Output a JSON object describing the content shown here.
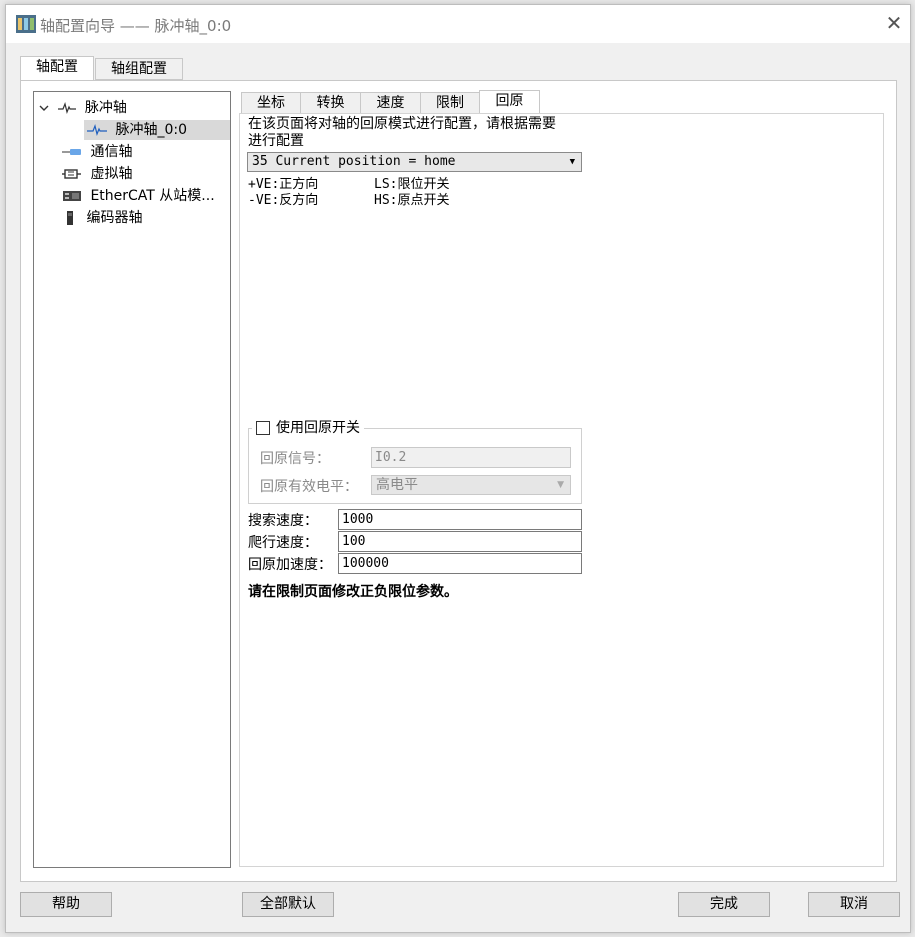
{
  "window": {
    "title": "轴配置向导 —— 脉冲轴_0:0"
  },
  "top_tabs": [
    {
      "label": "轴配置"
    },
    {
      "label": "轴组配置"
    }
  ],
  "tree": {
    "items": [
      {
        "label": "脉冲轴",
        "icon": "pulse-icon"
      },
      {
        "label": "脉冲轴_0:0",
        "icon": "pulse-icon"
      },
      {
        "label": "通信轴",
        "icon": "comm-axis-icon"
      },
      {
        "label": "虚拟轴",
        "icon": "virtual-axis-icon"
      },
      {
        "label": "EtherCAT 从站模...",
        "icon": "ethercat-icon"
      },
      {
        "label": "编码器轴",
        "icon": "encoder-icon"
      }
    ]
  },
  "sub_tabs": [
    {
      "label": "坐标"
    },
    {
      "label": "转换"
    },
    {
      "label": "速度"
    },
    {
      "label": "限制"
    },
    {
      "label": "回原"
    }
  ],
  "homing": {
    "description_line1": "在该页面将对轴的回原模式进行配置，请根据需要",
    "description_line2": "进行配置",
    "mode_value": "35 Current position = home",
    "legend": {
      "pve": "+VE:正方向",
      "ls": "LS:限位开关",
      "nve": "-VE:反方向",
      "hs": "HS:原点开关"
    },
    "use_switch_label": "使用回原开关",
    "signal_label": "回原信号：",
    "signal_value": "I0.2",
    "level_label": "回原有效电平：",
    "level_value": "高电平",
    "search_speed_label": "搜索速度：",
    "search_speed_value": "1000",
    "creep_speed_label": "爬行速度：",
    "creep_speed_value": "100",
    "accel_label": "回原加速度：",
    "accel_value": "100000",
    "note": "请在限制页面修改正负限位参数。"
  },
  "buttons": {
    "help": "帮助",
    "all_default": "全部默认",
    "finish": "完成",
    "cancel": "取消"
  }
}
